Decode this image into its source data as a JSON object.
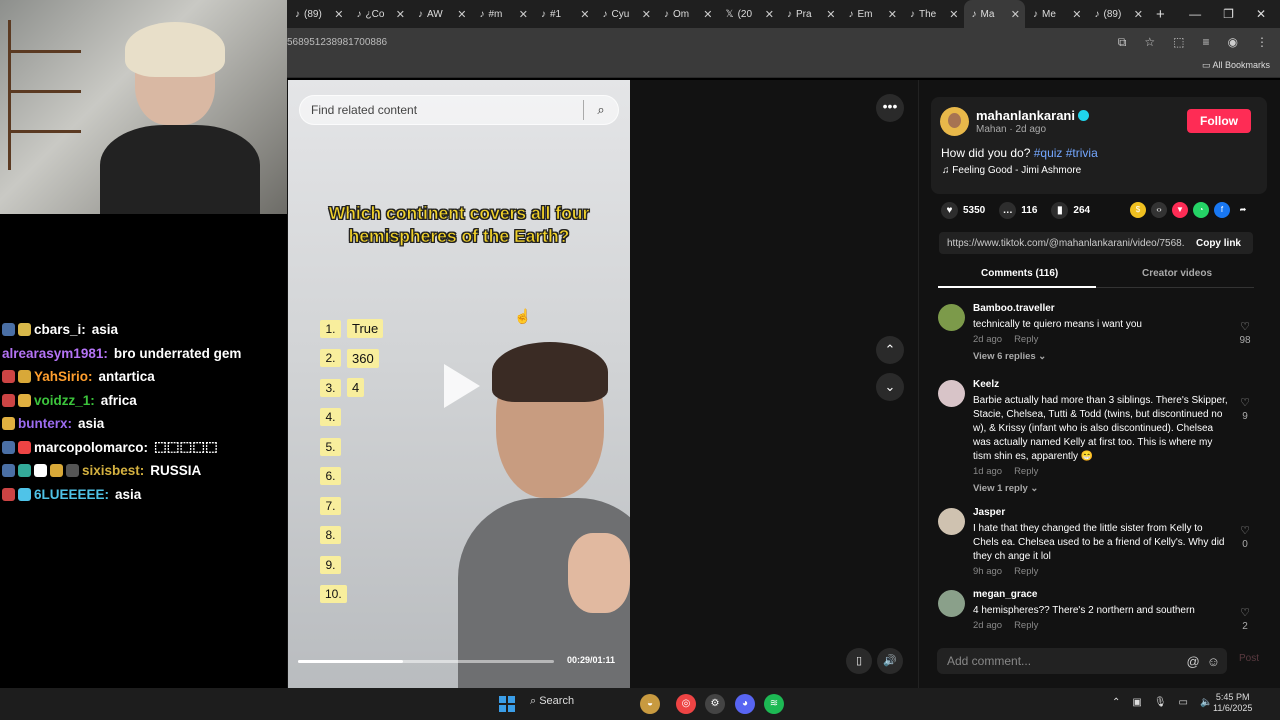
{
  "browser": {
    "tabs": [
      {
        "icon": "tiktok-icon",
        "label": "(89)"
      },
      {
        "icon": "tiktok-icon",
        "label": "¿Co"
      },
      {
        "icon": "tiktok-icon",
        "label": "AW"
      },
      {
        "icon": "tiktok-icon",
        "label": "#m"
      },
      {
        "icon": "tiktok-icon",
        "label": "#1"
      },
      {
        "icon": "tiktok-icon",
        "label": "Cyu"
      },
      {
        "icon": "tiktok-icon",
        "label": "Om"
      },
      {
        "icon": "x-icon",
        "label": "(20"
      },
      {
        "icon": "tiktok-icon",
        "label": "Pra"
      },
      {
        "icon": "tiktok-icon",
        "label": "Em"
      },
      {
        "icon": "tiktok-icon",
        "label": "The"
      },
      {
        "icon": "tiktok-icon",
        "label": "Ma",
        "active": true
      },
      {
        "icon": "tiktok-icon",
        "label": "Me"
      },
      {
        "icon": "tiktok-icon",
        "label": "(89)"
      }
    ],
    "url": "568951238981700886",
    "bookmarks_label": "All Bookmarks"
  },
  "chat": [
    {
      "user": "cbars_i:",
      "msg": "asia",
      "color": "#ffffff",
      "badges": [
        "#4a6fa5",
        "#d8b84a"
      ]
    },
    {
      "user": "alrearasym1981:",
      "msg": "bro underrated gem",
      "color": "#b473f5",
      "badges": []
    },
    {
      "user": "YahSirio:",
      "msg": "antartica",
      "color": "#ff9f2e",
      "badges": [
        "#c44",
        "#d8a838"
      ]
    },
    {
      "user": "voidzz_1:",
      "msg": "africa",
      "color": "#3cc43c",
      "badges": [
        "#c44",
        "#e0b040"
      ]
    },
    {
      "user": "bunterx:",
      "msg": "asia",
      "color": "#9c6cf0",
      "badges": [
        "#e0b040"
      ]
    },
    {
      "user": "marcopolomarco:",
      "msg": "⬚⬚⬚⬚⬚",
      "color": "#ffffff",
      "badges": [
        "#4a6fa5",
        "#e44"
      ]
    },
    {
      "user": "sixisbest:",
      "msg": "RUSSIA",
      "color": "#d4b140",
      "badges": [
        "#4a6fa5",
        "#3a9",
        "#fff",
        "#d8a838",
        "#555"
      ]
    },
    {
      "user": "6LUEEEEE:",
      "msg": "asia",
      "color": "#4fc3e8",
      "badges": [
        "#c44",
        "#4fc3e8"
      ]
    }
  ],
  "video": {
    "search_placeholder": "Find related content",
    "question": "Which continent covers all four hemispheres of the Earth?",
    "answers": [
      {
        "n": "1.",
        "v": "True"
      },
      {
        "n": "2.",
        "v": "360"
      },
      {
        "n": "3.",
        "v": "4"
      },
      {
        "n": "4.",
        "v": ""
      },
      {
        "n": "5.",
        "v": ""
      },
      {
        "n": "6.",
        "v": ""
      },
      {
        "n": "7.",
        "v": ""
      },
      {
        "n": "8.",
        "v": ""
      },
      {
        "n": "9.",
        "v": ""
      },
      {
        "n": "10.",
        "v": ""
      }
    ],
    "timecode": "00:29/01:11",
    "progress_fraction": 0.41
  },
  "post": {
    "username": "mahanlankarani",
    "display": "Mahan · 2d ago",
    "follow_label": "Follow",
    "caption_text": "How did you do?",
    "hashtags": "#quiz #trivia",
    "music": "♫  Feeling Good - Jimi Ashmore",
    "likes": "5350",
    "comments": "116",
    "saves": "264",
    "link": "https://www.tiktok.com/@mahanlankarani/video/7568...",
    "copy_label": "Copy link",
    "tab_comments": "Comments (116)",
    "tab_creator": "Creator videos"
  },
  "comments": [
    {
      "user": "Bamboo.traveller",
      "text": "technically te quiero means i want you",
      "age": "2d ago",
      "reply": "Reply",
      "replies": "View 6 replies ⌄",
      "likes": "98",
      "avatar": "#7c9a4a"
    },
    {
      "user": "Keelz",
      "text": "Barbie actually had more than 3 siblings. There's Skipper, Stacie, Chelsea, Tutti & Todd (twins, but discontinued no w), & Krissy (infant who is also discontinued). Chelsea was actually named Kelly at first too. This is where my tism shin es, apparently 😁",
      "age": "1d ago",
      "reply": "Reply",
      "replies": "View 1 reply ⌄",
      "likes": "9",
      "avatar": "#d8c4c8"
    },
    {
      "user": "Jasper",
      "text": "I hate that they changed the little sister from Kelly to Chels ea. Chelsea used to be a friend of Kelly's. Why did they ch ange it lol",
      "age": "9h ago",
      "reply": "Reply",
      "replies": "",
      "likes": "0",
      "avatar": "#cfc2b0"
    },
    {
      "user": "megan_grace",
      "text": "4 hemispheres?? There's 2 northern and southern",
      "age": "2d ago",
      "reply": "Reply",
      "replies": "",
      "likes": "2",
      "avatar": "#8aa08a"
    }
  ],
  "add_comment_placeholder": "Add comment...",
  "post_label": "Post",
  "taskbar": {
    "search_label": "Search",
    "time": "5:45 PM",
    "date": "11/6/2025"
  }
}
